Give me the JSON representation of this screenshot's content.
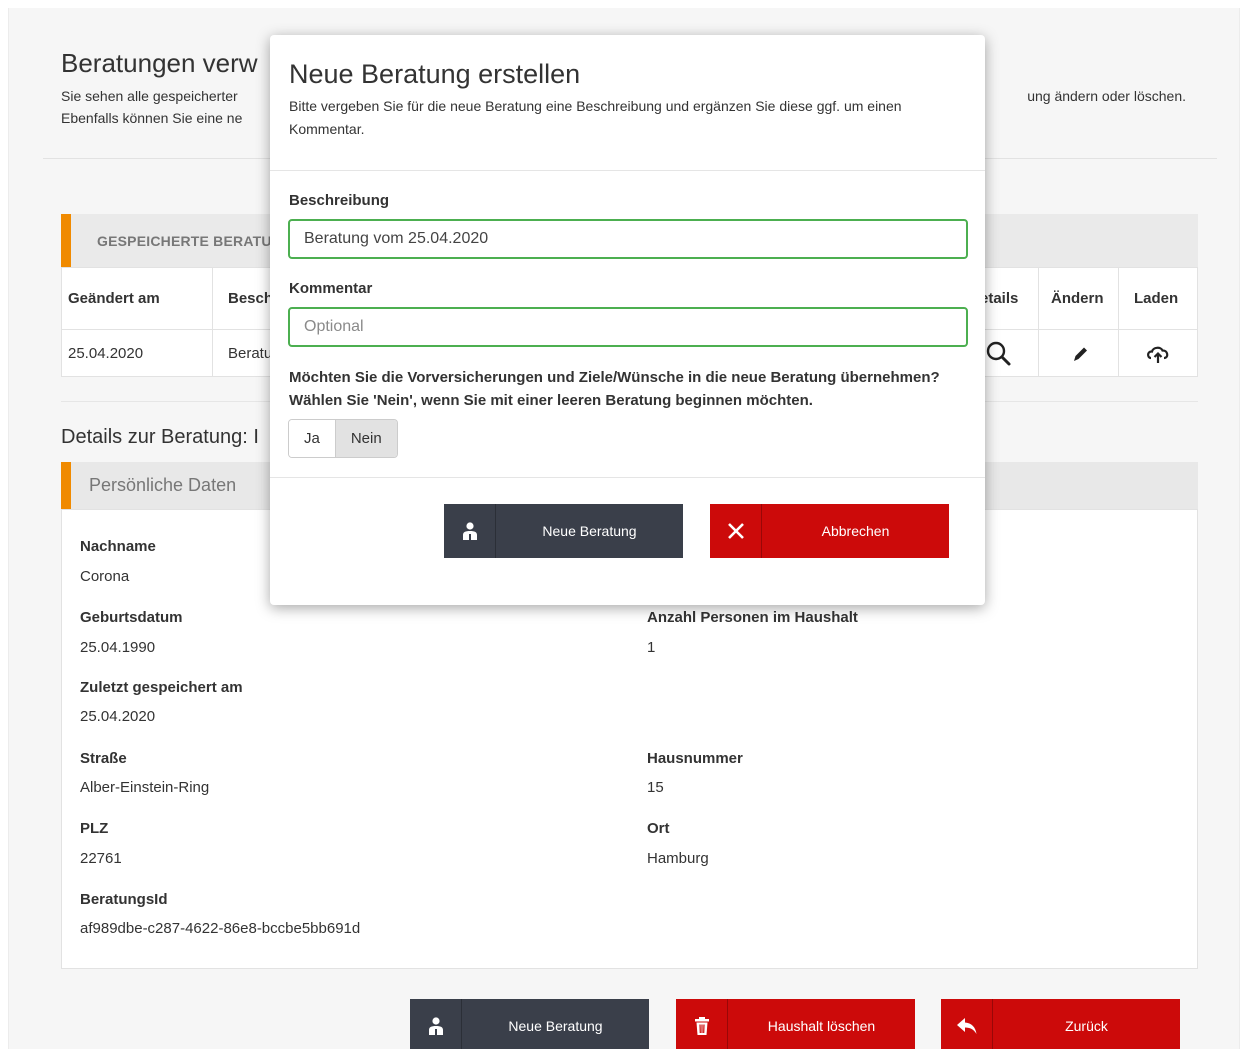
{
  "page": {
    "title": "Beratungen verw",
    "intro_line1_left": "Sie sehen alle gespeicherter",
    "intro_line1_right": "ung ändern oder löschen.",
    "intro_line2_left": "Ebenfalls können Sie eine ne"
  },
  "saved": {
    "header": "GESPEICHERTE BERATU",
    "columns": {
      "changed": "Geändert am",
      "description": "Besch",
      "details": "etails",
      "edit": "Ändern",
      "load": "Laden"
    },
    "rows": [
      {
        "changed": "25.04.2020",
        "description": "Beratu"
      }
    ]
  },
  "details": {
    "title": "Details zur Beratung: I",
    "section": "Persönliche Daten",
    "fields": {
      "nachname": {
        "label": "Nachname",
        "value": "Corona"
      },
      "geburtsdatum": {
        "label": "Geburtsdatum",
        "value": "25.04.1990"
      },
      "personen": {
        "label": "Anzahl Personen im Haushalt",
        "value": "1"
      },
      "gespeichert": {
        "label": "Zuletzt gespeichert am",
        "value": "25.04.2020"
      },
      "strasse": {
        "label": "Straße",
        "value": "Alber-Einstein-Ring"
      },
      "hausnummer": {
        "label": "Hausnummer",
        "value": "15"
      },
      "plz": {
        "label": "PLZ",
        "value": "22761"
      },
      "ort": {
        "label": "Ort",
        "value": "Hamburg"
      },
      "beratungsid": {
        "label": "BeratungsId",
        "value": "af989dbe-c287-4622-86e8-bccbe5bb691d"
      }
    }
  },
  "actions": {
    "new": "Neue Beratung",
    "delete": "Haushalt löschen",
    "back": "Zurück"
  },
  "modal": {
    "title": "Neue Beratung erstellen",
    "intro": "Bitte vergeben Sie für die neue Beratung eine Beschreibung und ergänzen Sie diese ggf. um einen Kommentar.",
    "description_label": "Beschreibung",
    "description_value": "Beratung vom 25.04.2020",
    "comment_label": "Kommentar",
    "comment_placeholder": "Optional",
    "question": "Möchten Sie die Vorversicherungen und Ziele/Wünsche in die neue Beratung übernehmen? Wählen Sie 'Nein', wenn Sie mit einer leeren Beratung beginnen möchten.",
    "option_yes": "Ja",
    "option_no": "Nein",
    "selected_option": "Nein",
    "confirm": "Neue Beratung",
    "cancel": "Abbrechen"
  },
  "colors": {
    "accent": "#f08a00",
    "dark_button": "#3a3f4a",
    "danger": "#cc0a0a",
    "valid_border": "#4caf50"
  },
  "icons": [
    "search-icon",
    "pencil-icon",
    "cloud-upload-icon",
    "users-icon",
    "trash-icon",
    "reply-icon",
    "close-icon"
  ]
}
